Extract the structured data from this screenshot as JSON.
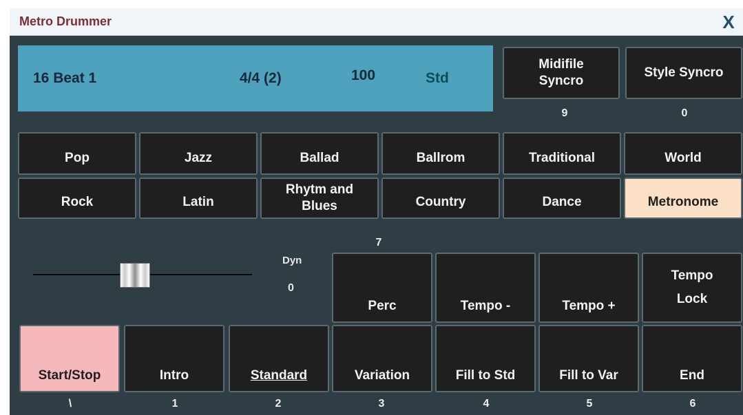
{
  "window": {
    "title": "Metro Drummer",
    "close_label": "X"
  },
  "display": {
    "style_name": "16 Beat 1",
    "time_signature": "4/4 (2)",
    "tempo": "100",
    "mode": "Std"
  },
  "sync": {
    "midifile": {
      "line1": "Midifile",
      "line2": "Syncro",
      "key": "9"
    },
    "style": {
      "label": "Style Syncro",
      "key": "0"
    }
  },
  "genres": {
    "row1": [
      "Pop",
      "Jazz",
      "Ballad",
      "Ballrom",
      "Traditional",
      "World"
    ],
    "row2": [
      "Rock",
      "Latin",
      "Rhytm and Blues",
      "Country",
      "Dance",
      "Metronome"
    ],
    "rhythm_blues_line1": "Rhytm and",
    "rhythm_blues_line2": "Blues"
  },
  "dynamics": {
    "label": "Dyn",
    "value": "0",
    "slider_level": 0.46
  },
  "controls": {
    "perc_key": "7",
    "perc": "Perc",
    "tempo_minus": "Tempo -",
    "tempo_plus": "Tempo +",
    "tempo_lock_line1": "Tempo",
    "tempo_lock_line2": "Lock"
  },
  "sections": [
    {
      "label": "Start/Stop",
      "key": "\\"
    },
    {
      "label": "Intro",
      "key": "1"
    },
    {
      "label": "Standard",
      "key": "2"
    },
    {
      "label": "Variation",
      "key": "3"
    },
    {
      "label": "Fill to Std",
      "key": "4"
    },
    {
      "label": "Fill to Var",
      "key": "5"
    },
    {
      "label": "End",
      "key": "6"
    }
  ],
  "colors": {
    "background": "#2f3d45",
    "display": "#4fa2be",
    "metronome_active": "#fbe0c7",
    "start_stop": "#f5b8bb",
    "button": "#1f1f1f"
  }
}
